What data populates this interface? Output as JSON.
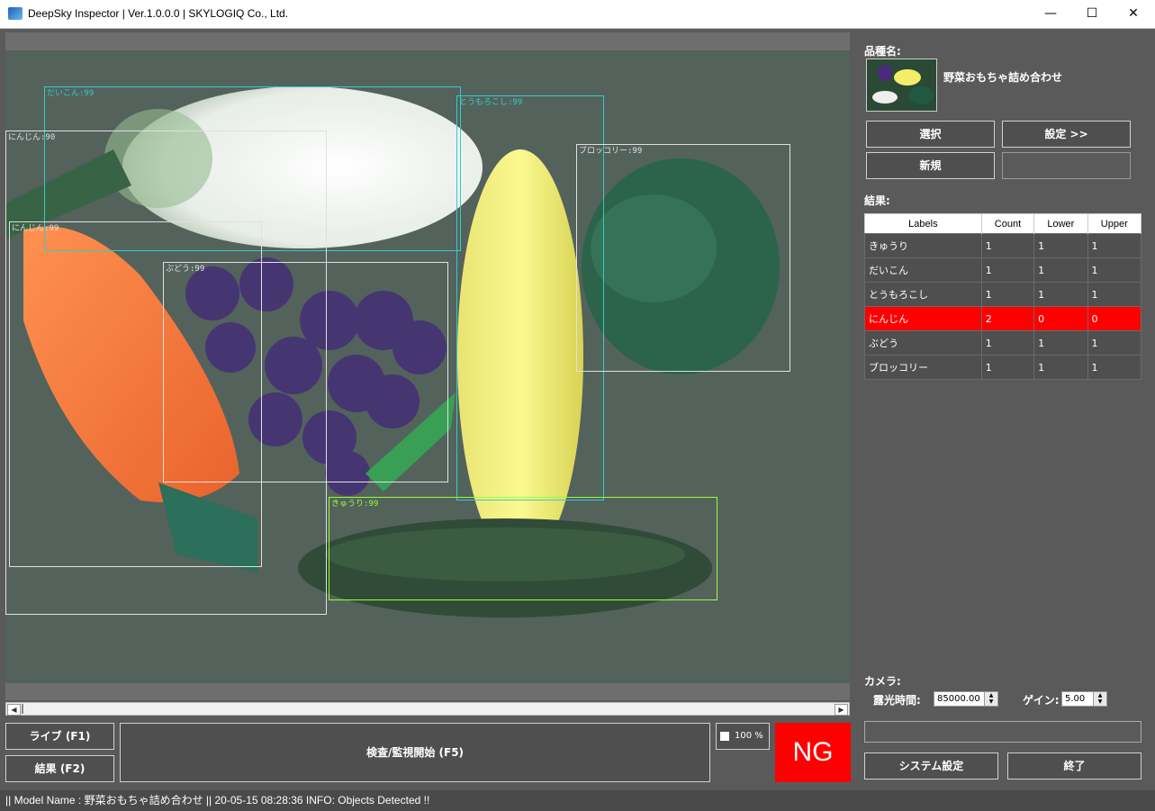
{
  "window": {
    "title": "DeepSky Inspector | Ver.1.0.0.0 | SKYLOGIQ Co., Ltd.",
    "minimize": "—",
    "maximize": "☐",
    "close": "✕"
  },
  "detections": [
    {
      "label": "だいこん:99",
      "color": "#33cccc"
    },
    {
      "label": "にんじん:90",
      "color": "#e0e0e0"
    },
    {
      "label": "にんじん:99",
      "color": "#e0e0e0"
    },
    {
      "label": "とうもろこし:99",
      "color": "#33cccc"
    },
    {
      "label": "ブロッコリー:99",
      "color": "#e0e0e0"
    },
    {
      "label": "ぶどう:99",
      "color": "#e0e0e0"
    },
    {
      "label": "きゅうり:99",
      "color": "#99ff33"
    }
  ],
  "scrollbar": {
    "left_arrow": "◀",
    "right_arrow": "▶"
  },
  "controls": {
    "live": "ライブ (F1)",
    "results": "結果 (F2)",
    "inspect": "検査/監視開始 (F5)",
    "zoom": "100 %",
    "judgement": "NG"
  },
  "status": {
    "text": "|| Model Name : 野菜おもちゃ詰め合わせ ||    20-05-15 08:28:36   INFO:   Objects Detected !!"
  },
  "panel": {
    "product_label": "品種名:",
    "product_name": "野菜おもちゃ詰め合わせ",
    "select": "選択",
    "settings": "設定 >>",
    "new": "新規",
    "results_label": "結果:",
    "camera_label": "カメラ:",
    "exposure_label": "露光時間:",
    "exposure_value": "85000.00",
    "gain_label": "ゲイン:",
    "gain_value": "5.00",
    "system_settings": "システム設定",
    "exit": "終了"
  },
  "results_table": {
    "headers": [
      "Labels",
      "Count",
      "Lower",
      "Upper"
    ],
    "rows": [
      {
        "label": "きゅうり",
        "count": "1",
        "lower": "1",
        "upper": "1",
        "ng": false
      },
      {
        "label": "だいこん",
        "count": "1",
        "lower": "1",
        "upper": "1",
        "ng": false
      },
      {
        "label": "とうもろこし",
        "count": "1",
        "lower": "1",
        "upper": "1",
        "ng": false
      },
      {
        "label": "にんじん",
        "count": "2",
        "lower": "0",
        "upper": "0",
        "ng": true
      },
      {
        "label": "ぶどう",
        "count": "1",
        "lower": "1",
        "upper": "1",
        "ng": false
      },
      {
        "label": "ブロッコリー",
        "count": "1",
        "lower": "1",
        "upper": "1",
        "ng": false
      }
    ]
  },
  "colors": {
    "ng": "#ff0000",
    "background": "#5a5a5a"
  }
}
